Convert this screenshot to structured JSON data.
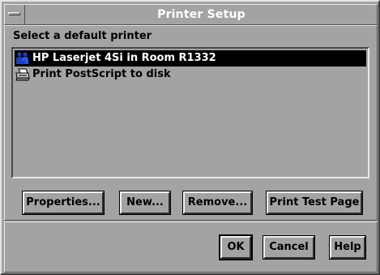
{
  "window": {
    "title": "Printer Setup"
  },
  "printers": {
    "label": "Select a default printer",
    "items": [
      {
        "name": "HP Laserjet 4Si in Room R1332",
        "icon": "network-printer-icon",
        "selected": true
      },
      {
        "name": "Print PostScript to disk",
        "icon": "printer-icon",
        "selected": false
      }
    ]
  },
  "actions": {
    "properties": "Properties...",
    "new": "New...",
    "remove": "Remove...",
    "print_test_page": "Print Test Page"
  },
  "footer": {
    "ok": "OK",
    "cancel": "Cancel",
    "help": "Help"
  },
  "colors": {
    "background": "#a3a3a3",
    "selection": "#000000",
    "selection_text": "#ffffff",
    "title_text": "#ffffff",
    "network_icon": "#1e3cc8"
  }
}
